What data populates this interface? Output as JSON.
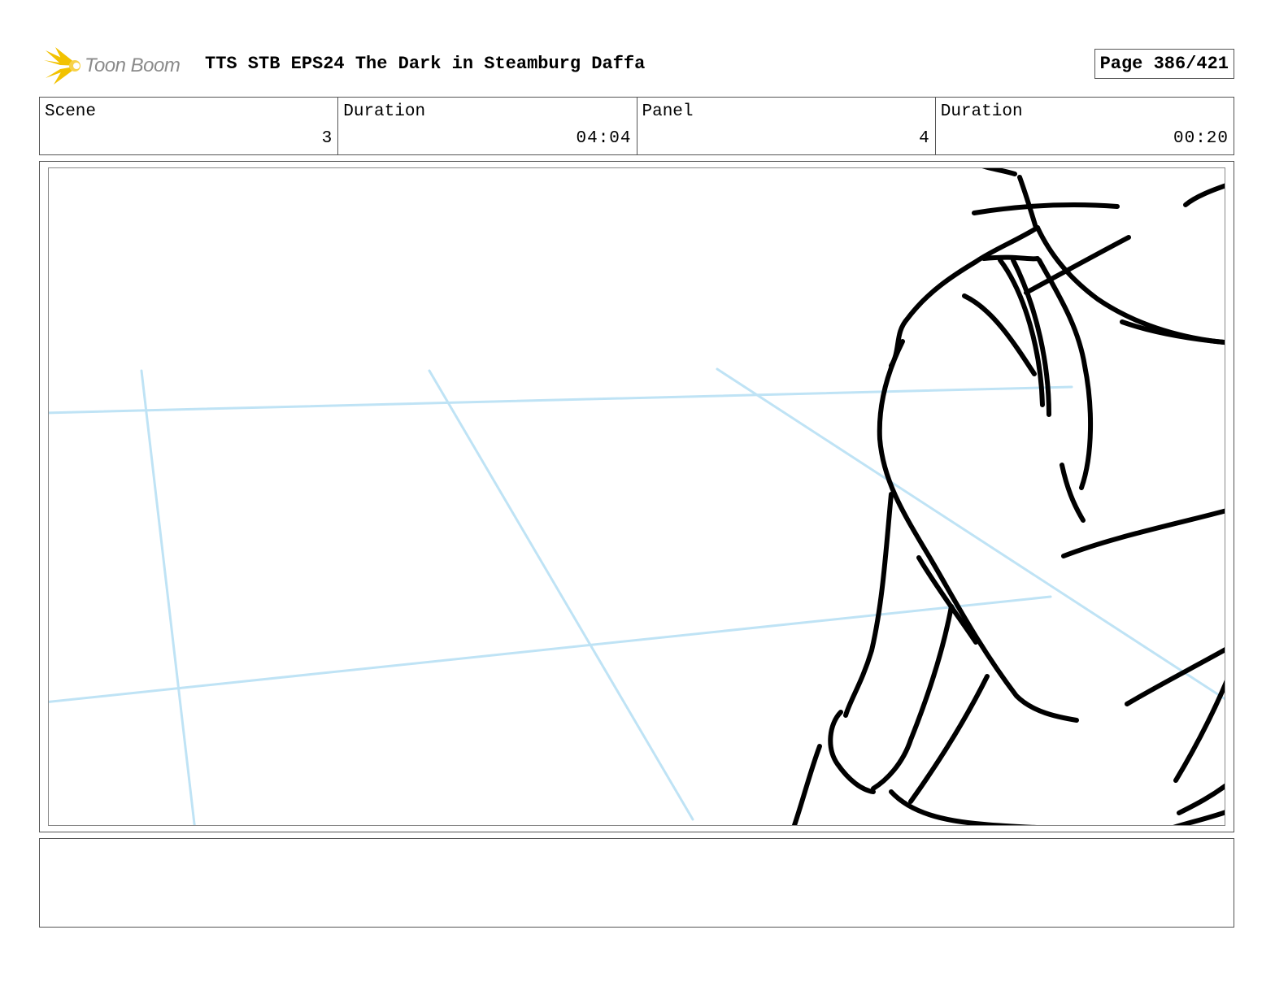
{
  "header": {
    "logo_text": "Toon Boom",
    "title": "TTS STB EPS24 The Dark in Steamburg Daffa",
    "page": "Page 386/421"
  },
  "info": {
    "scene_label": "Scene",
    "scene_value": "3",
    "duration_label": "Duration",
    "duration_value": "04:04",
    "panel_label": "Panel",
    "panel_value": "4",
    "panel_duration_label": "Duration",
    "panel_duration_value": "00:20"
  },
  "colors": {
    "logo_accent": "#f2c200",
    "guide_lines": "#bfe3f5",
    "sketch_ink": "#000000"
  },
  "notes": {
    "text": ""
  }
}
